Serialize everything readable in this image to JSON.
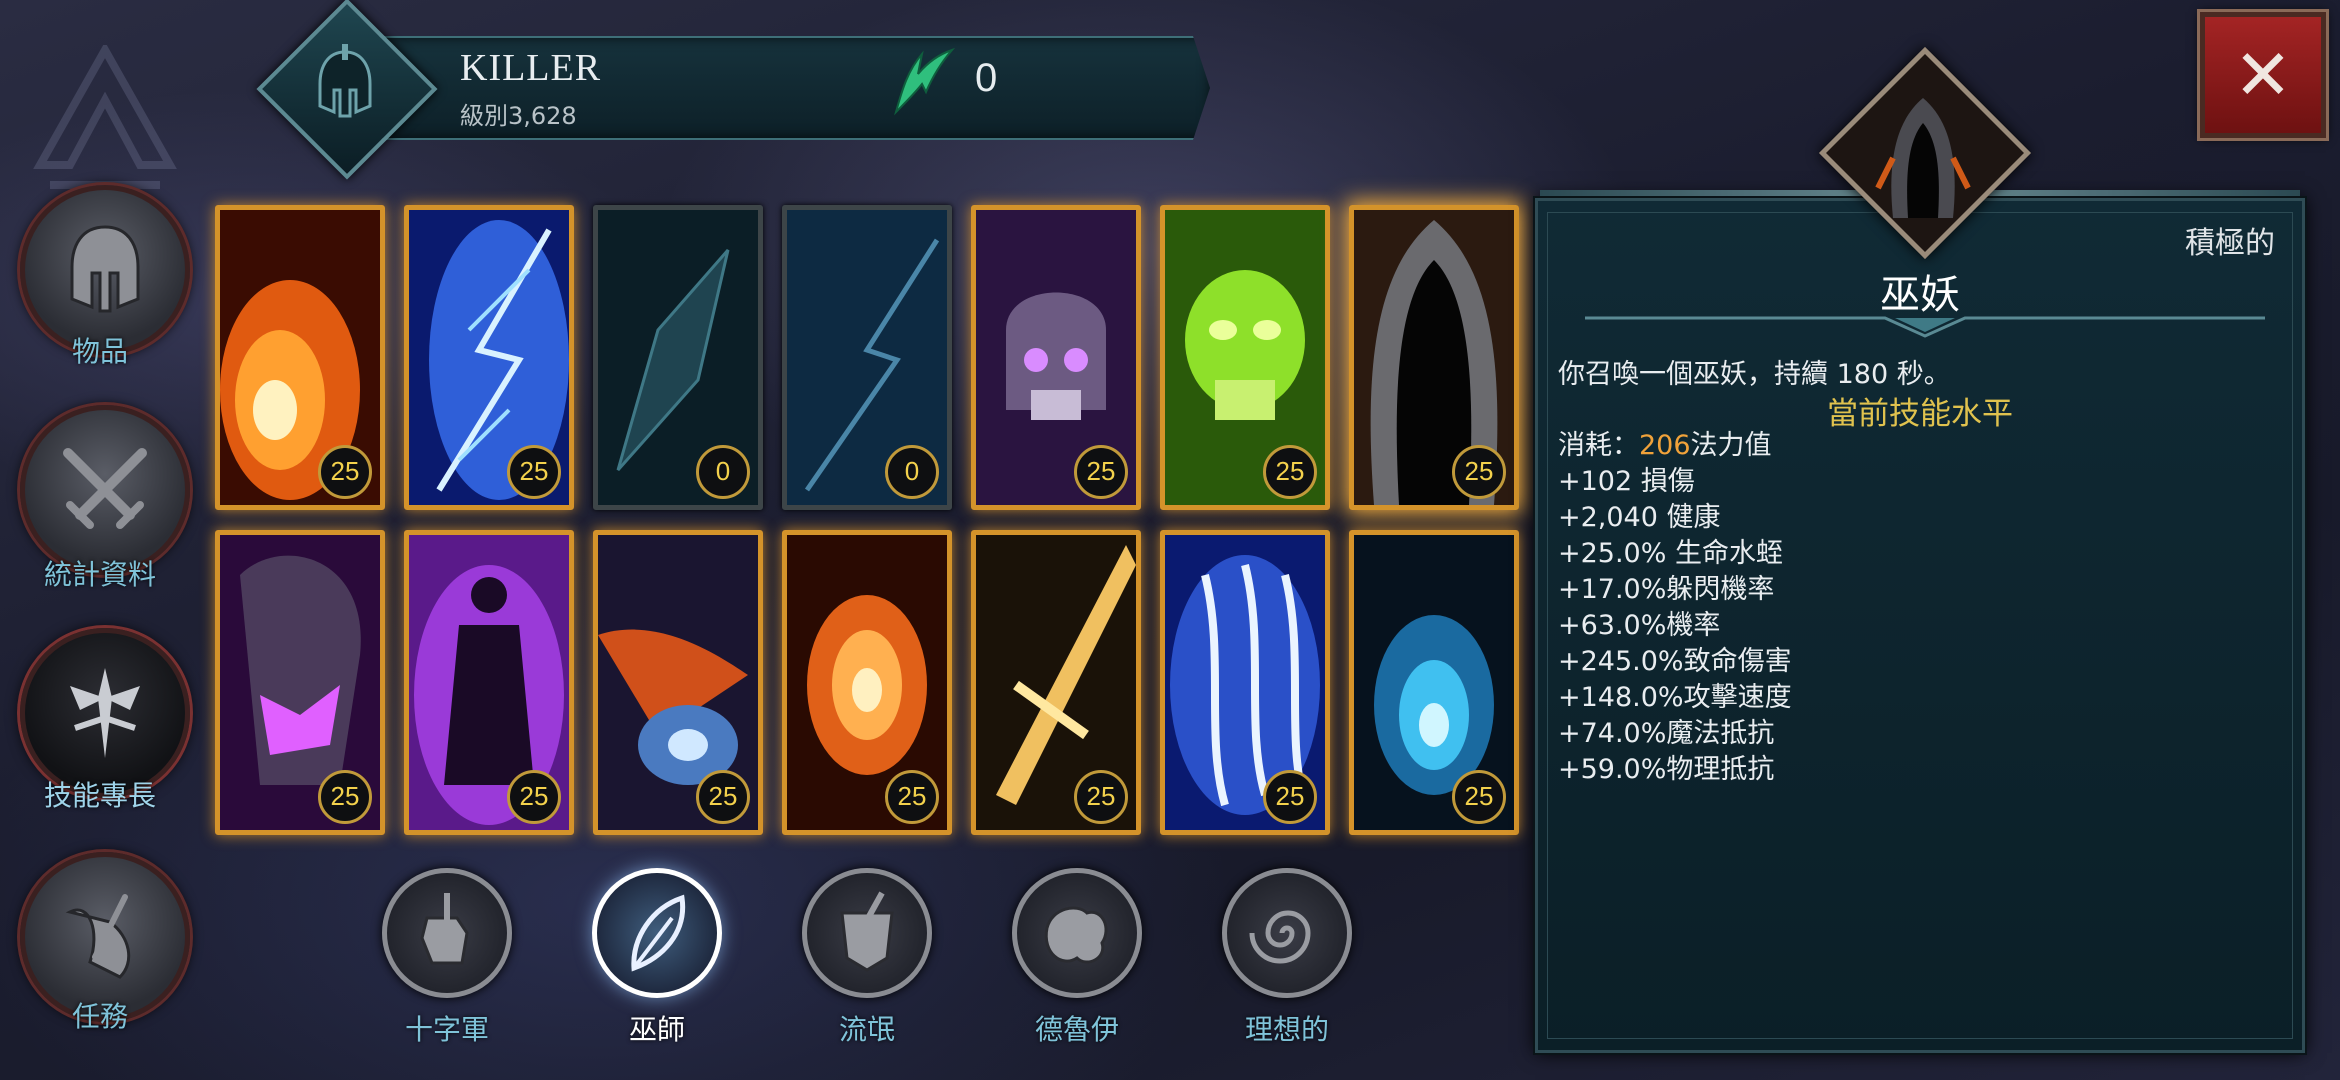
{
  "header": {
    "player_name": "KILLER",
    "player_level": "級別3,628",
    "resource_value": "0",
    "avatar_icon": "spartan-helmet-icon",
    "resource_icon": "green-claw-icon"
  },
  "nav": {
    "items": [
      {
        "label": "物品",
        "icon": "helmet-icon"
      },
      {
        "label": "統計資料",
        "icon": "crossed-swords-icon"
      },
      {
        "label": "技能專長",
        "icon": "skill-tree-icon",
        "active": true
      },
      {
        "label": "任務",
        "icon": "scroll-quill-icon"
      }
    ]
  },
  "skills": {
    "row1": [
      {
        "name": "fire-skill",
        "level": "25"
      },
      {
        "name": "lightning-skill",
        "level": "25"
      },
      {
        "name": "dark-shard-skill",
        "level": "0"
      },
      {
        "name": "storm-skill",
        "level": "0"
      },
      {
        "name": "skeleton-skill",
        "level": "25"
      },
      {
        "name": "green-skull-skill",
        "level": "25"
      },
      {
        "name": "lich-skill",
        "level": "25",
        "selected": true
      }
    ],
    "row2": [
      {
        "name": "shadow-mask-skill",
        "level": "25"
      },
      {
        "name": "shadow-figure-skill",
        "level": "25"
      },
      {
        "name": "meteor-skill",
        "level": "25"
      },
      {
        "name": "flame-swirl-skill",
        "level": "25"
      },
      {
        "name": "sword-skill",
        "level": "25"
      },
      {
        "name": "ice-claw-skill",
        "level": "25"
      },
      {
        "name": "blue-fire-skill",
        "level": "25"
      }
    ]
  },
  "classes": [
    {
      "label": "十字軍",
      "icon": "fist-icon"
    },
    {
      "label": "巫師",
      "icon": "feather-icon",
      "active": true
    },
    {
      "label": "流氓",
      "icon": "rogue-mask-icon"
    },
    {
      "label": "德魯伊",
      "icon": "beast-claw-icon"
    },
    {
      "label": "理想的",
      "icon": "spiral-hand-icon"
    }
  ],
  "detail": {
    "active_label": "積極的",
    "skill_name": "巫妖",
    "description": "你召喚一個巫妖，持續 180 秒。",
    "current_level_label": "當前技能水平",
    "cost_prefix": "消耗：",
    "cost_value": "206",
    "cost_suffix": "法力值",
    "stats": [
      "+102 損傷",
      "+2,040 健康",
      "+25.0% 生命水蛭",
      "+17.0%躲閃機率",
      "+63.0%機率",
      "+245.0%致命傷害",
      "+148.0%攻擊速度",
      "+74.0%魔法抵抗",
      "+59.0%物理抵抗"
    ]
  },
  "close_label": "✕"
}
